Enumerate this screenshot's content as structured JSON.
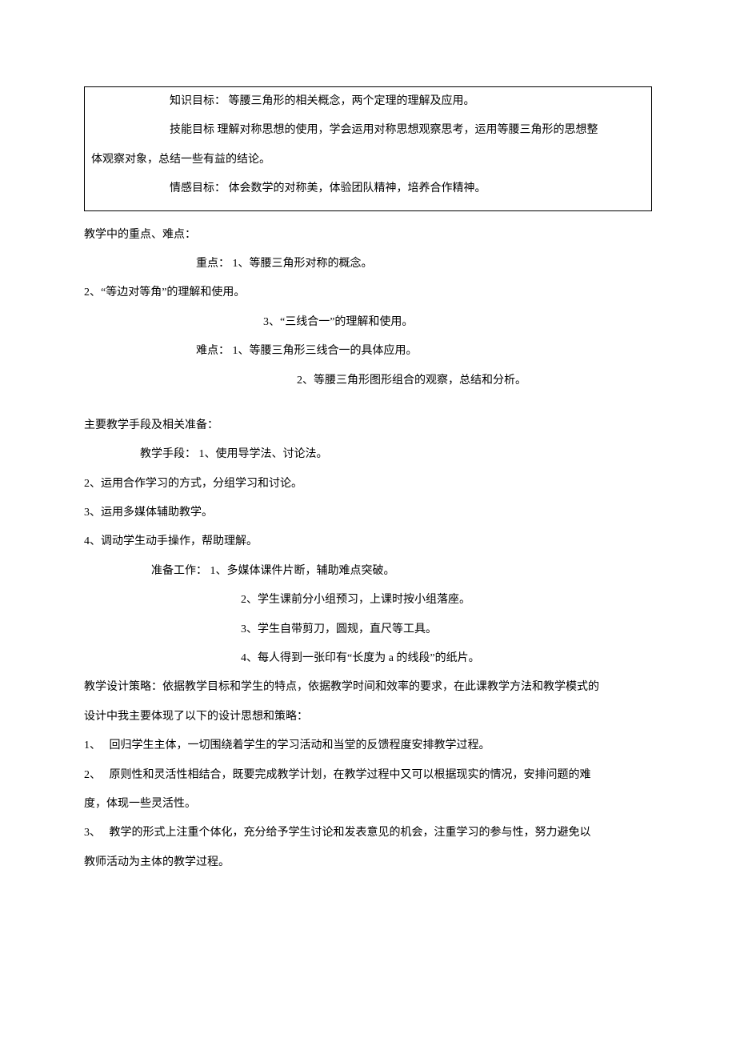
{
  "boxed": {
    "knowledge_label": "知识目标：",
    "knowledge_text": " 等腰三角形的相关概念，两个定理的理解及应用。",
    "skill_label": "技能目标",
    "skill_text_1": " 理解对称思想的使用，学会运用对称思想观察思考，运用等腰三角形的思想整",
    "skill_text_2": "体观察对象，总结一些有益的结论。",
    "emotion_label": "情感目标：",
    "emotion_text": " 体会数学的对称美，体验团队精神，培养合作精神。"
  },
  "difficulties": {
    "heading": "教学中的重点、难点：",
    "focus_label": "重点：",
    "focus_1": " 1、等腰三角形对称的概念。",
    "focus_2": "2、“等边对等角”的理解和使用。",
    "focus_3": "3、“三线合一”的理解和使用。",
    "diff_label": "难点：",
    "diff_1": " 1、等腰三角形三线合一的具体应用。",
    "diff_2": "2、等腰三角形图形组合的观察，总结和分析。"
  },
  "methods": {
    "heading": "主要教学手段及相关准备：",
    "means_label": "教学手段：",
    "means_1": " 1、使用导学法、讨论法。",
    "means_2": "2、运用合作学习的方式，分组学习和讨论。",
    "means_3": "3、运用多媒体辅助教学。",
    "means_4": "4、调动学生动手操作，帮助理解。",
    "prep_label": "准备工作：",
    "prep_1": " 1、多媒体课件片断，辅助难点突破。",
    "prep_2": "2、学生课前分小组预习，上课时按小组落座。",
    "prep_3": "3、学生自带剪刀，圆规，直尺等工具。",
    "prep_4": "4、每人得到一张印有“长度为 a 的线段”的纸片。"
  },
  "strategy": {
    "intro_1": "教学设计策略：依据教学目标和学生的特点，依据教学时间和效率的要求，在此课教学方法和教学模式的",
    "intro_2": "设计中我主要体现了以下的设计思想和策略：",
    "s1": "1、　 回归学生主体，一切围绕着学生的学习活动和当堂的反馈程度安排教学过程。",
    "s2_a": "2、　 原则性和灵活性相结合，既要完成教学计划，在教学过程中又可以根据现实的情况，安排问题的难",
    "s2_b": "度，体现一些灵活性。",
    "s3_a": "3、　 教学的形式上注重个体化，充分给予学生讨论和发表意见的机会，注重学习的参与性，努力避免以",
    "s3_b": "教师活动为主体的教学过程。"
  }
}
